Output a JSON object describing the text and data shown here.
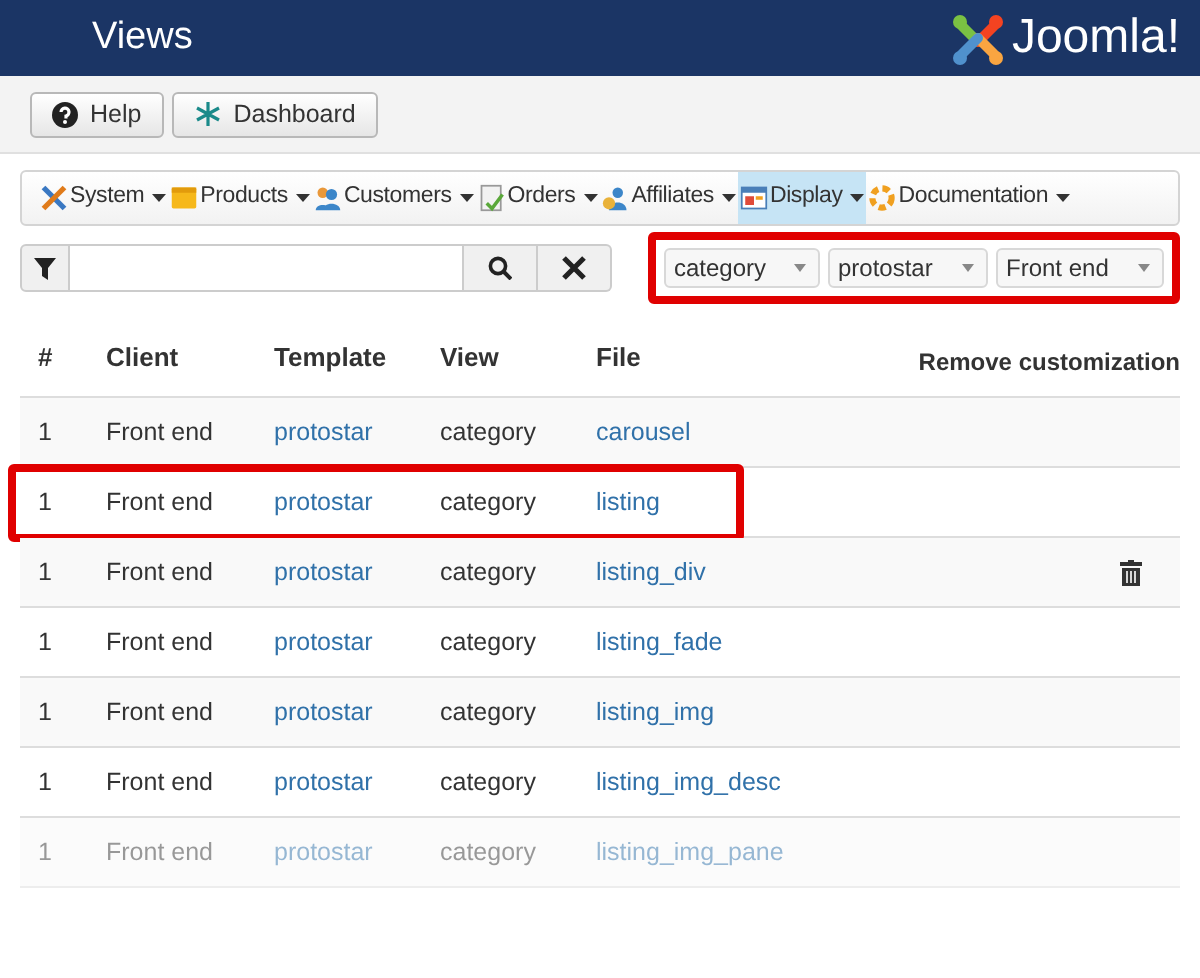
{
  "header": {
    "title": "Views",
    "logo_text": "Joomla!"
  },
  "toolbar": [
    {
      "label": "Help",
      "kind": "help"
    },
    {
      "label": "Dashboard",
      "kind": "dashboard"
    }
  ],
  "menu": [
    {
      "label": "System",
      "selected": false
    },
    {
      "label": "Products",
      "selected": false
    },
    {
      "label": "Customers",
      "selected": false
    },
    {
      "label": "Orders",
      "selected": false
    },
    {
      "label": "Affiliates",
      "selected": false
    },
    {
      "label": "Display",
      "selected": true
    },
    {
      "label": "Documentation",
      "selected": false
    }
  ],
  "filter_bar": {
    "highlighted": true,
    "selects": [
      "category",
      "protostar",
      "Front end"
    ]
  },
  "table": {
    "columns": [
      "#",
      "Client",
      "Template",
      "View",
      "File",
      "Remove customization"
    ],
    "rows": [
      {
        "cells": [
          "1",
          "Front end",
          "protostar",
          "category",
          "carousel"
        ],
        "removable": false,
        "highlighted": false,
        "faded": false
      },
      {
        "cells": [
          "1",
          "Front end",
          "protostar",
          "category",
          "listing"
        ],
        "removable": false,
        "highlighted": true,
        "faded": false
      },
      {
        "cells": [
          "1",
          "Front end",
          "protostar",
          "category",
          "listing_div"
        ],
        "removable": true,
        "highlighted": false,
        "faded": false
      },
      {
        "cells": [
          "1",
          "Front end",
          "protostar",
          "category",
          "listing_fade"
        ],
        "removable": false,
        "highlighted": false,
        "faded": false
      },
      {
        "cells": [
          "1",
          "Front end",
          "protostar",
          "category",
          "listing_img"
        ],
        "removable": false,
        "highlighted": false,
        "faded": false
      },
      {
        "cells": [
          "1",
          "Front end",
          "protostar",
          "category",
          "listing_img_desc"
        ],
        "removable": false,
        "highlighted": false,
        "faded": false
      },
      {
        "cells": [
          "1",
          "Front end",
          "protostar",
          "category",
          "listing_img_pane"
        ],
        "removable": false,
        "highlighted": false,
        "faded": true
      }
    ]
  }
}
